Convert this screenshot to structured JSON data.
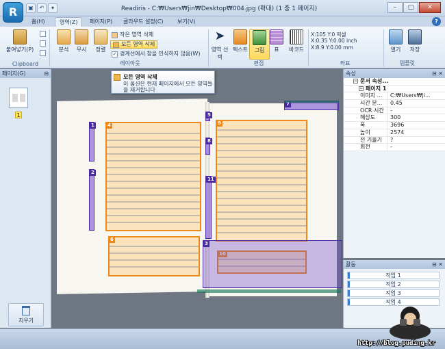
{
  "app": {
    "title": "Readiris - C:₩Users₩jin₩Desktop₩004.jpg (확대) (1 중 1 페이지)",
    "logo_letter": "R",
    "quick_access": [
      "save-icon",
      "undo-icon",
      "dropdown-icon"
    ],
    "window_buttons": {
      "minimize": "–",
      "maximize": "□",
      "close": "✕"
    }
  },
  "tabs": [
    {
      "label": "홈(H)",
      "active": false
    },
    {
      "label": "영역(Z)",
      "active": true
    },
    {
      "label": "페이지(P)",
      "active": false
    },
    {
      "label": "클라우드 설정(C)",
      "active": false
    },
    {
      "label": "보기(V)",
      "active": false
    }
  ],
  "help_label": "?",
  "ribbon": {
    "clipboard": {
      "paste_label": "붙여넣기(P)",
      "group_label": "Clipboard"
    },
    "layout": {
      "analyze_label": "분석",
      "ignore_label": "무시",
      "sort_label": "정렬",
      "delete_selected_label": "작은 영역 삭제",
      "delete_all_label": "모든 영역 삭제",
      "ignore_borders_label": "경계선에서 창을 인식하지 않음(W)",
      "group_label": "레이아웃"
    },
    "edit": {
      "select_label": "영역 선택",
      "text_label": "텍스트",
      "image_label": "그림",
      "table_label": "표",
      "barcode_label": "바코드",
      "group_label": "편집"
    },
    "coords": {
      "line1": "X:105 Y:0 픽셀",
      "line2": "X:0.35 Y:0.00 inch",
      "line3": "X:8.9 Y:0.00 mm",
      "group_label": "좌표"
    },
    "template": {
      "open_label": "열기",
      "save_label": "저장",
      "group_label": "템플릿"
    }
  },
  "left_pane": {
    "title": "페이지(G)",
    "page_number": "1",
    "trash_label": "지우기"
  },
  "tooltip": {
    "title": "모든 영역 삭제",
    "description": "이 옵션은 현재 페이지에서 모든 영역들을 제거합니다"
  },
  "zones": {
    "text_labels": [
      "4",
      "6",
      "9",
      "10"
    ],
    "purple_labels": [
      "1",
      "2",
      "5",
      "8",
      "11",
      "3",
      "7"
    ]
  },
  "properties": {
    "title": "속성",
    "category": "문서 속성...",
    "subcategory": "페이지 1",
    "rows": [
      {
        "key": "이미지 ...",
        "value": "C:₩Users₩ji..."
      },
      {
        "key": "시간 분...",
        "value": "0.45"
      },
      {
        "key": "OCR 시간",
        "value": "-"
      },
      {
        "key": "해상도",
        "value": "300"
      },
      {
        "key": "폭",
        "value": "3696"
      },
      {
        "key": "높이",
        "value": "2574"
      },
      {
        "key": "전 기울기",
        "value": "?"
      },
      {
        "key": "회전",
        "value": "-"
      }
    ]
  },
  "activity": {
    "title": "활동",
    "tasks": [
      "작업 1",
      "작업 2",
      "작업 3",
      "작업 4"
    ]
  },
  "watermark": "http://blog.puding.kr",
  "colors": {
    "accent": "#2d6db7",
    "zone_text": "#ee8b18",
    "zone_image": "#4a2aa0",
    "highlight": "#ffd95c"
  }
}
